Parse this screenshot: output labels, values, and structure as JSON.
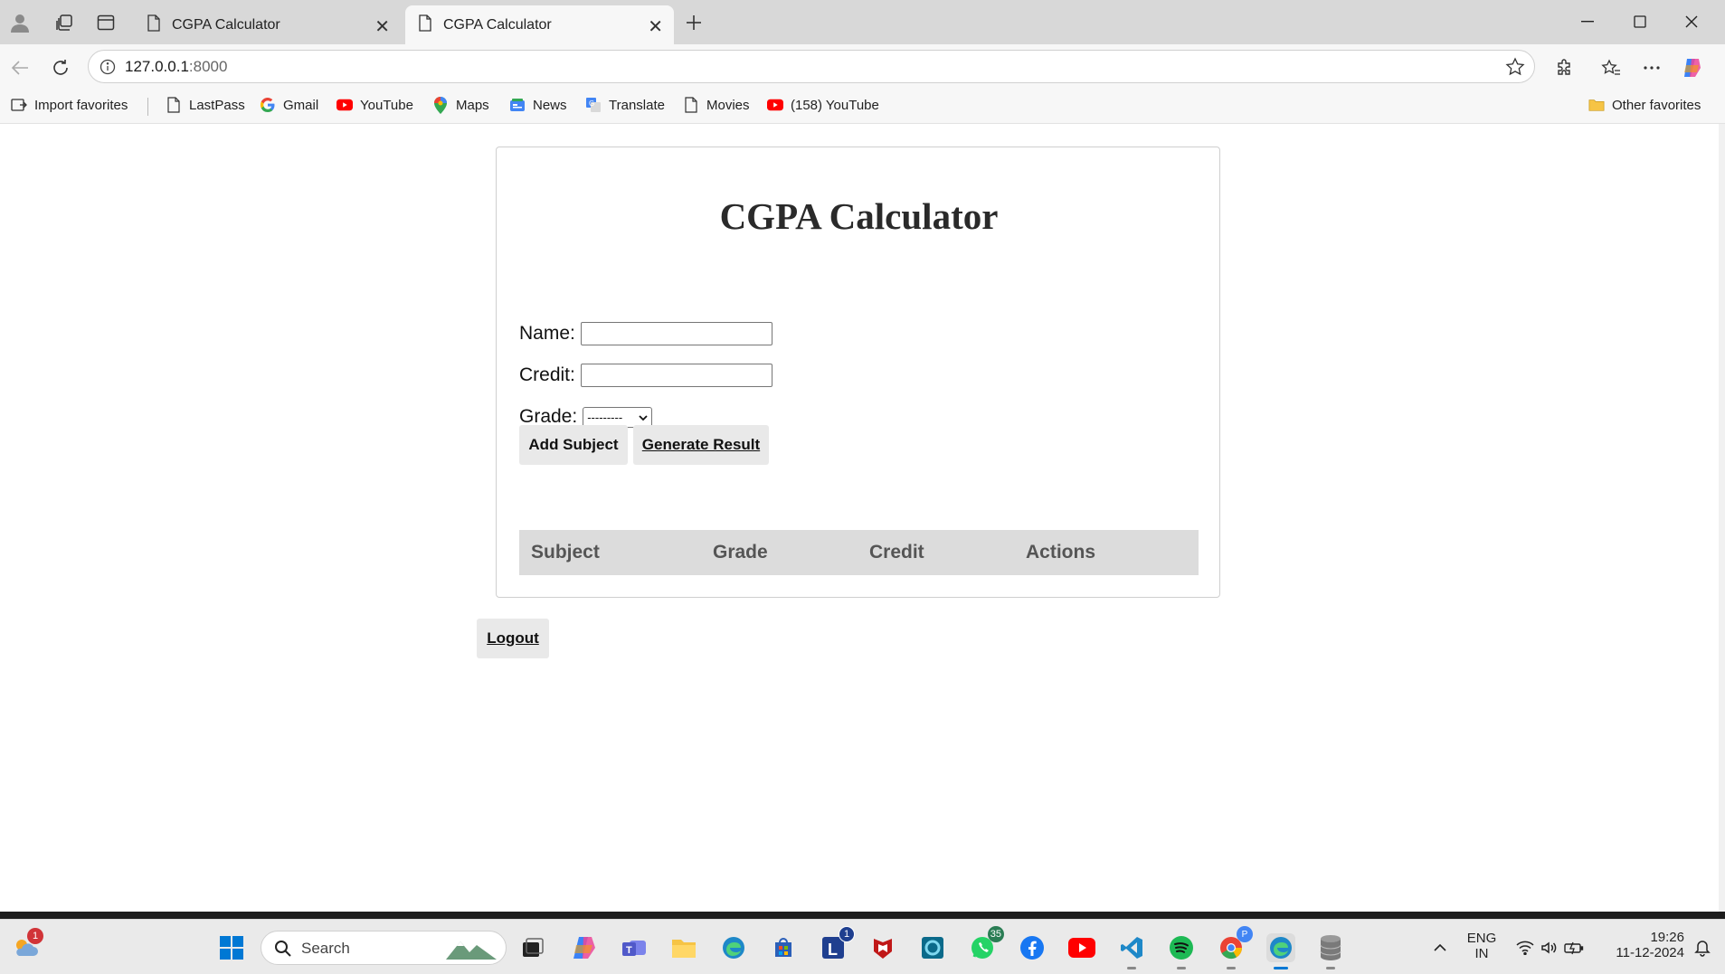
{
  "browser": {
    "tabs": [
      {
        "title": "CGPA Calculator",
        "active": false
      },
      {
        "title": "CGPA Calculator",
        "active": true
      }
    ],
    "url_host": "127.0.0.1",
    "url_port": ":8000",
    "bookmarks": [
      {
        "label": "Import favorites",
        "icon": "import-icon"
      },
      {
        "label": "LastPass",
        "icon": "page-icon"
      },
      {
        "label": "Gmail",
        "icon": "google-icon"
      },
      {
        "label": "YouTube",
        "icon": "youtube-icon"
      },
      {
        "label": "Maps",
        "icon": "maps-pin-icon"
      },
      {
        "label": "News",
        "icon": "news-icon"
      },
      {
        "label": "Translate",
        "icon": "translate-icon"
      },
      {
        "label": "Movies",
        "icon": "page-icon"
      },
      {
        "label": "(158) YouTube",
        "icon": "youtube-icon"
      }
    ],
    "other_favorites": "Other favorites"
  },
  "page": {
    "title": "CGPA Calculator",
    "form": {
      "name_label": "Name:",
      "name_value": "",
      "credit_label": "Credit:",
      "credit_value": "",
      "grade_label": "Grade:",
      "grade_selected": "---------"
    },
    "buttons": {
      "add_subject": "Add Subject",
      "generate_result": "Generate Result",
      "logout": "Logout"
    },
    "table": {
      "columns": [
        "Subject",
        "Grade",
        "Credit",
        "Actions"
      ],
      "rows": []
    }
  },
  "taskbar": {
    "weather_badge": "1",
    "search_placeholder": "Search",
    "app_badges": {
      "l_app": "1",
      "whatsapp": "35"
    },
    "tray": {
      "lang_line1": "ENG",
      "lang_line2": "IN",
      "time": "19:26",
      "date": "11-12-2024"
    }
  },
  "colors": {
    "youtube": "#ff0000",
    "accent_taskbar": "#0078d4",
    "whatsapp": "#25d366",
    "spotify": "#1db954",
    "mcafee": "#c01818"
  }
}
